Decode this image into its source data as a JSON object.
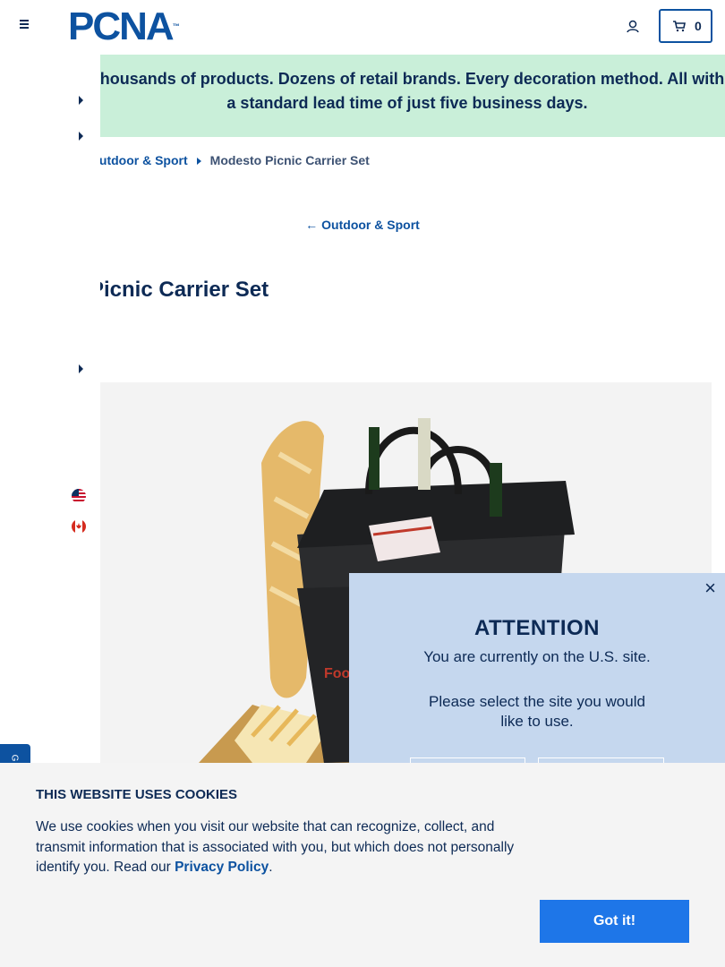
{
  "header": {
    "logo_text": "PCNA",
    "logo_tm": "™",
    "cart_count": "0"
  },
  "banner": {
    "text": "Thousands of products. Dozens of retail brands. Every decoration method. All with a standard lead time of just five business days."
  },
  "breadcrumb": {
    "parent": "Outdoor & Sport",
    "current": "Modesto Picnic Carrier Set"
  },
  "back_link": {
    "label": "Outdoor & Sport"
  },
  "product": {
    "title": "Picnic Carrier Set"
  },
  "modal": {
    "close": "×",
    "heading": "ATTENTION",
    "line1": "You are currently on the U.S. site.",
    "line2": "Please select the site you would like to use."
  },
  "side_tab": {
    "label": "G"
  },
  "cookie": {
    "heading": "THIS WEBSITE USES COOKIES",
    "text_before": "We use cookies when you visit our website that can recognize, collect, and transmit information that is associated with you, but which does not personally identify you. Read our ",
    "link": "Privacy Policy",
    "text_after": ".",
    "button": "Got it!"
  }
}
